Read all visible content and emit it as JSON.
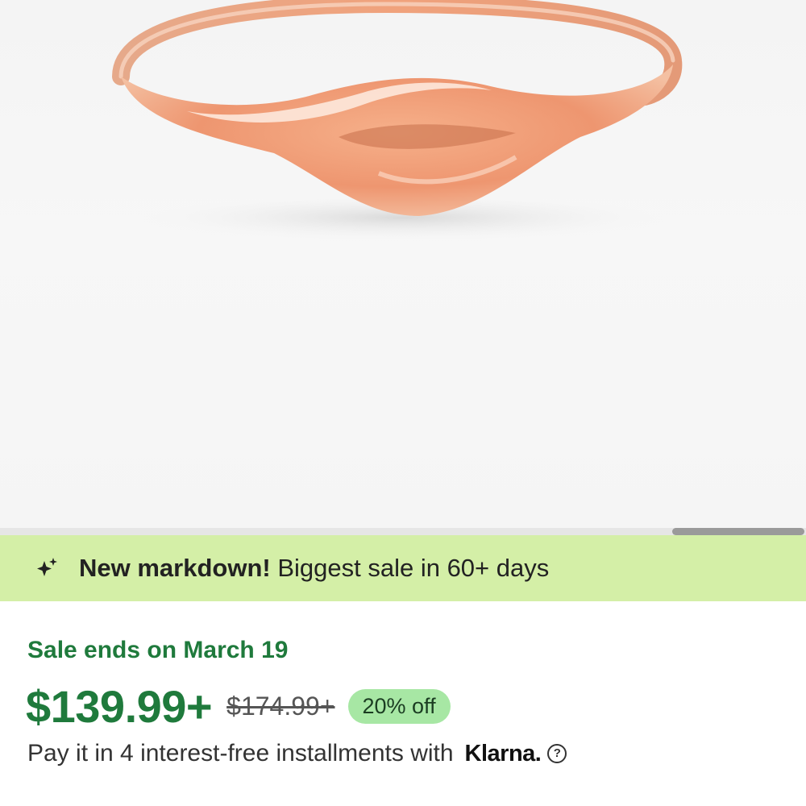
{
  "banner": {
    "icon": "sparkle-icon",
    "highlight": "New markdown!",
    "text": " Biggest sale in 60+ days",
    "background": "#d4efa7"
  },
  "sale": {
    "ends_label": "Sale ends on March 19",
    "price": "$139.99+",
    "original_price": "$174.99+",
    "discount": "20% off",
    "accent_color": "#1f7a3c"
  },
  "payment": {
    "text": "Pay it in 4 interest-free installments with",
    "provider": "Klarna.",
    "help_icon": "question-circle-icon",
    "help_glyph": "?"
  },
  "gallery": {
    "image": "rose-gold-signet-ring-photo"
  }
}
